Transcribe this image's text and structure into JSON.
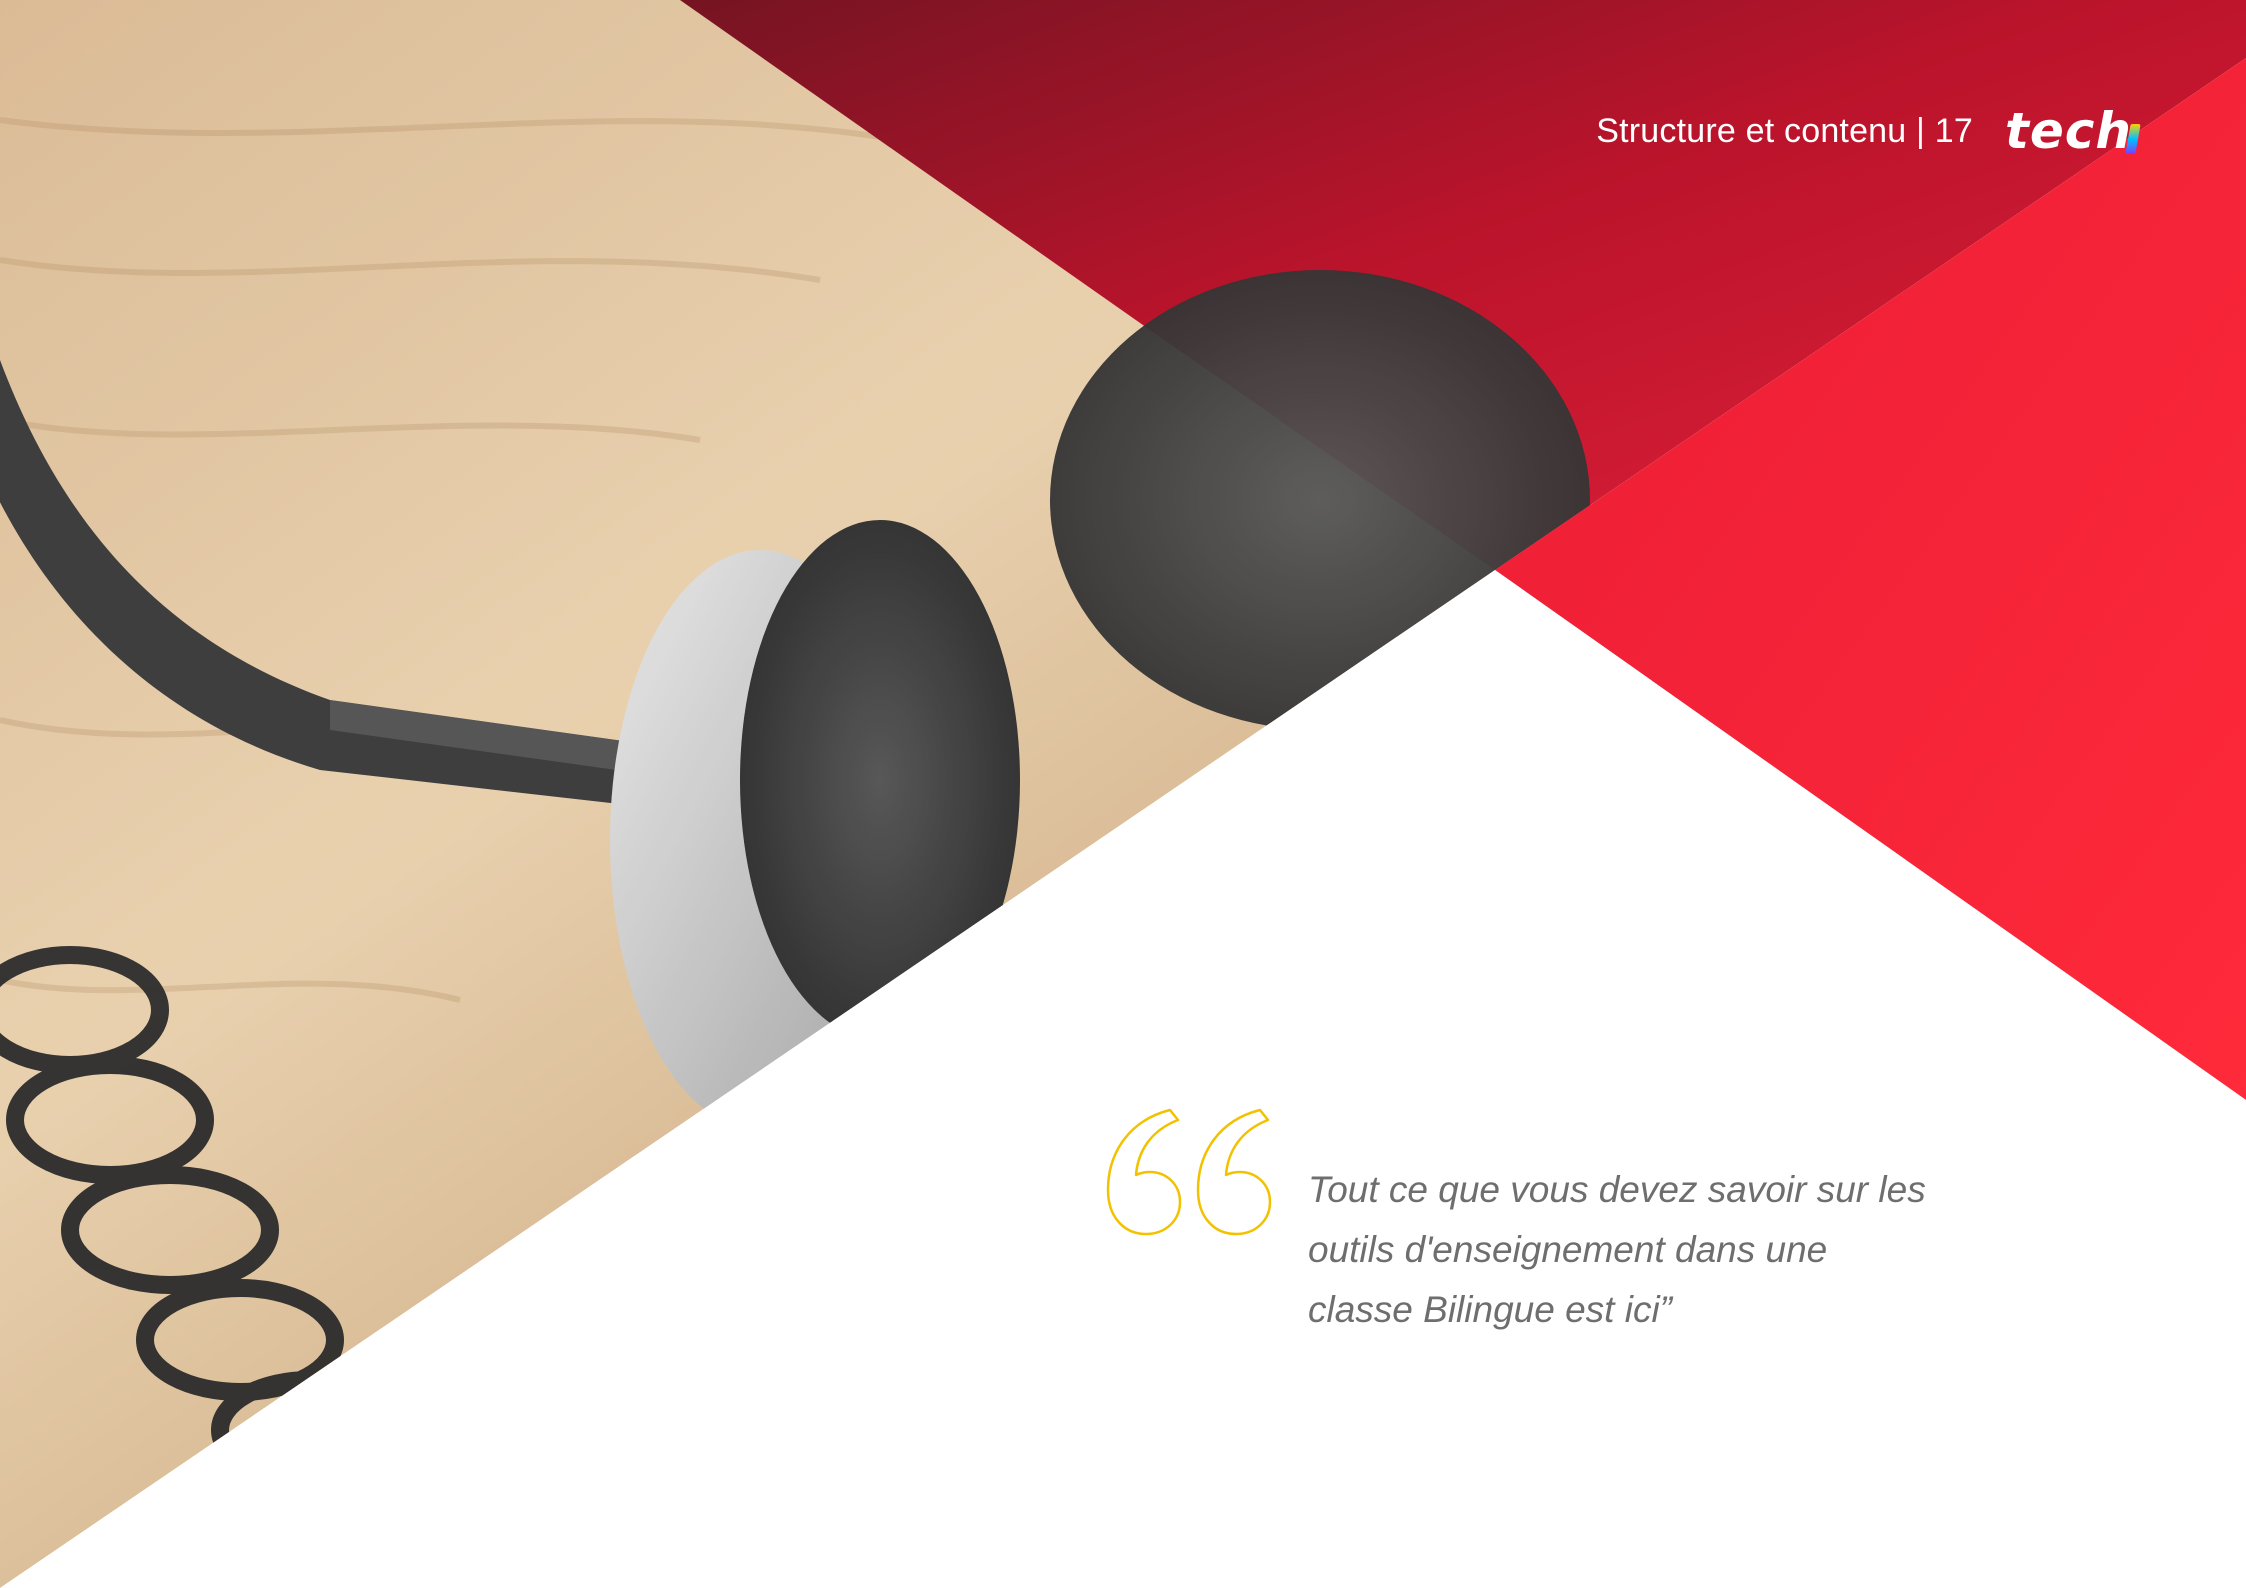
{
  "header": {
    "section_label": "Structure et contenu | 17",
    "logo_text": "tech"
  },
  "quote": {
    "text": "Tout ce que vous devez savoir sur les outils d'enseignement dans une classe Bilingue est ici”",
    "mark_icon": "open-quote-icon",
    "mark_color": "#f2c200"
  },
  "colors": {
    "brand_red": "#ff2233",
    "text_gray": "#6e6e6e",
    "background": "#ffffff"
  }
}
